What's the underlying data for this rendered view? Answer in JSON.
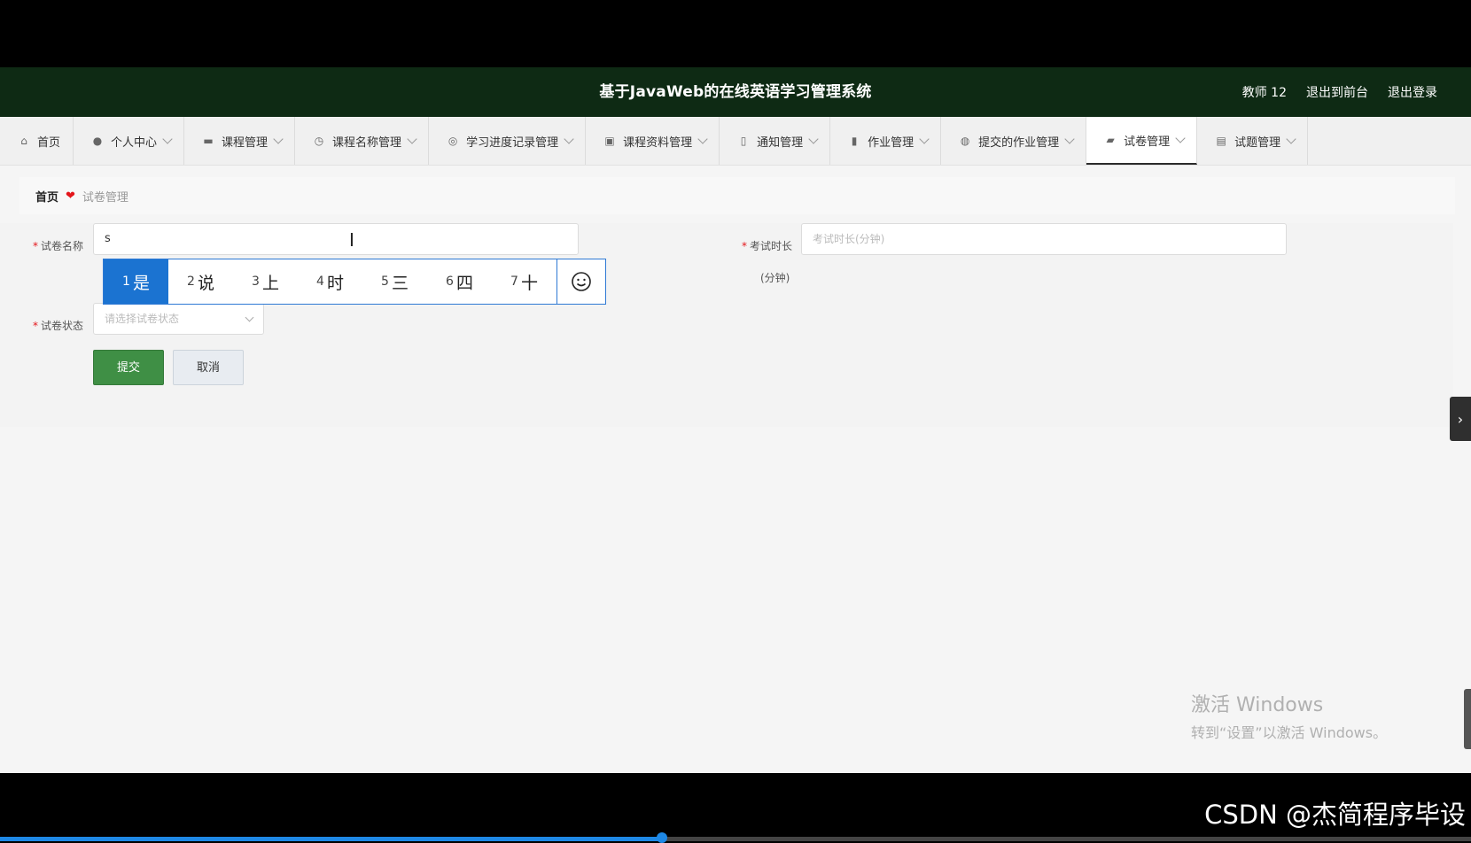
{
  "header": {
    "title": "基于JavaWeb的在线英语学习管理系统",
    "user": "教师 12",
    "to_front": "退出到前台",
    "logout": "退出登录"
  },
  "nav": [
    {
      "label": "首页",
      "icon": "home-icon"
    },
    {
      "label": "个人中心",
      "icon": "user-icon"
    },
    {
      "label": "课程管理",
      "icon": "book-icon"
    },
    {
      "label": "课程名称管理",
      "icon": "clock-icon"
    },
    {
      "label": "学习进度记录管理",
      "icon": "compass-icon"
    },
    {
      "label": "课程资料管理",
      "icon": "briefcase-icon"
    },
    {
      "label": "通知管理",
      "icon": "bell-icon"
    },
    {
      "label": "作业管理",
      "icon": "bar-chart-icon"
    },
    {
      "label": "提交的作业管理",
      "icon": "globe-icon"
    },
    {
      "label": "试卷管理",
      "icon": "message-icon"
    },
    {
      "label": "试题管理",
      "icon": "clipboard-icon"
    }
  ],
  "nav_active": "试卷管理",
  "breadcrumb": {
    "home": "首页",
    "current": "试卷管理"
  },
  "form": {
    "paper_name_label": "试卷名称",
    "paper_name_value": "s",
    "duration_label": "考试时长",
    "duration_placeholder": "考试时长(分钟)",
    "duration_unit": "(分钟)",
    "status_label": "试卷状态",
    "status_placeholder": "请选择试卷状态",
    "submit": "提交",
    "cancel": "取消"
  },
  "ime": {
    "candidates": [
      {
        "num": "1",
        "text": "是"
      },
      {
        "num": "2",
        "text": "说"
      },
      {
        "num": "3",
        "text": "上"
      },
      {
        "num": "4",
        "text": "时"
      },
      {
        "num": "5",
        "text": "三"
      },
      {
        "num": "6",
        "text": "四"
      },
      {
        "num": "7",
        "text": "十"
      }
    ],
    "emoji_icon": "smiley-icon"
  },
  "watermark": {
    "line1": "激活 Windows",
    "line2": "转到“设置”以激活 Windows。"
  },
  "csdn": "CSDN @杰简程序毕设",
  "video_progress": 0.45,
  "colors": {
    "header_bg": "#0e2a14",
    "submit_bg": "#3f8f45",
    "ime_blue": "#1b73d1"
  }
}
